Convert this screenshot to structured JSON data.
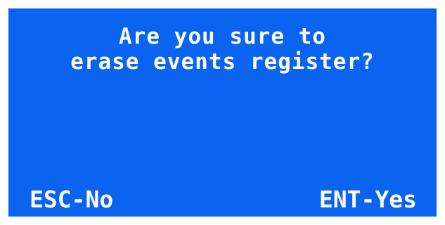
{
  "theme": {
    "screen_background": "#0a64f0",
    "text_color": "#ffffff",
    "frame_color": "#ffffff"
  },
  "dialog": {
    "question_line_1": "Are you sure to",
    "question_line_2": "erase events register?"
  },
  "softkeys": {
    "cancel_label": "ESC-No",
    "confirm_label": "ENT-Yes"
  }
}
